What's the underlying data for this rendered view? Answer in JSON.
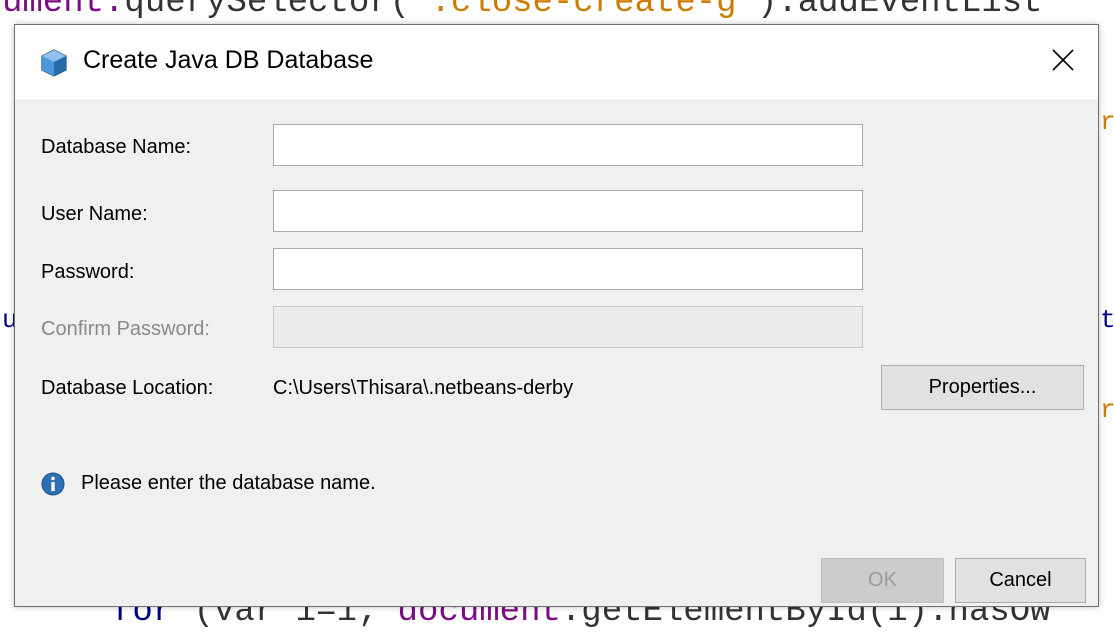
{
  "background": {
    "code_line1_a": "ument.",
    "code_line1_b": "querySelector(",
    "code_line1_c": "'.close-create-g'",
    "code_line1_d": ").addEventList",
    "code_line2_a": "for",
    "code_line2_b": " (var i=1; ",
    "code_line2_c": "document",
    "code_line2_d": ".getElementById(i).hasOw",
    "frag_left": "u",
    "frag_right_top": "r",
    "frag_right_mid": "t",
    "frag_right_low": "r"
  },
  "dialog": {
    "title": "Create Java DB Database",
    "fields": {
      "database_name_label": "Database Name:",
      "database_name_value": "",
      "user_name_label": "User Name:",
      "user_name_value": "",
      "password_label": "Password:",
      "password_value": "",
      "confirm_password_label": "Confirm Password:",
      "confirm_password_value": ""
    },
    "location": {
      "label": "Database Location:",
      "value": "C:\\Users\\Thisara\\.netbeans-derby",
      "properties_button": "Properties..."
    },
    "info_message": "Please enter the database name.",
    "buttons": {
      "ok": "OK",
      "cancel": "Cancel"
    }
  },
  "colors": {
    "dialog_bg": "#f0f0f0",
    "titlebar_bg": "#ffffff",
    "info_icon": "#2f6fb5",
    "disabled_text": "#8a8a8a"
  },
  "icons": {
    "app": "java-db-cube-icon",
    "close": "close-icon",
    "info": "info-icon"
  }
}
